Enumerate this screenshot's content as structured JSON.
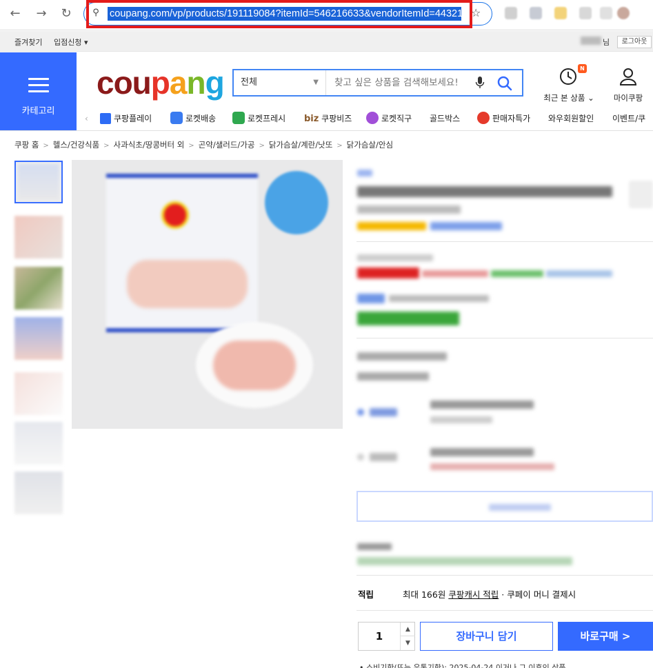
{
  "browser": {
    "url": "coupang.com/vp/products/191119084?itemId=546216633&vendorItemId=44321",
    "back_icon": "arrow-left-icon",
    "forward_icon": "arrow-right-icon",
    "reload_icon": "reload-icon"
  },
  "util_bar": {
    "bookmark": "즐겨찾기",
    "seller_signup": "입점신청 ▾",
    "user_suffix": "님",
    "logout": "로그아웃"
  },
  "header": {
    "category_label": "카테고리",
    "logo": [
      "cou",
      "p",
      "a",
      "n",
      "g"
    ],
    "search_category": "전체",
    "search_placeholder": "찾고 싶은 상품을 검색해보세요!",
    "recent_label": "최근 본 상품 ⌄",
    "recent_badge": "N",
    "mypage_label": "마이쿠팡"
  },
  "gnb": {
    "items": [
      {
        "label": "쿠팡플레이",
        "color": "#2d6cf5"
      },
      {
        "label": "로켓배송",
        "color": "#3a7bf0"
      },
      {
        "label": "로켓프레시",
        "color": "#2fa84f"
      },
      {
        "label": "쿠팡비즈",
        "prefix": "biz",
        "color": "#8a5a2b"
      },
      {
        "label": "로켓직구",
        "color": "#a14fd8"
      },
      {
        "label": "골드박스",
        "color": ""
      },
      {
        "label": "판매자특가",
        "color": "#e53a2b"
      },
      {
        "label": "와우회원할인",
        "color": ""
      },
      {
        "label": "이벤트/쿠",
        "color": ""
      }
    ]
  },
  "breadcrumb": [
    "쿠팡 홈",
    "헬스/건강식품",
    "사과식초/땅콩버터 외",
    "곤약/샐러드/가공",
    "닭가슴살/계란/낫또",
    "닭가슴살/안심"
  ],
  "purchase": {
    "reward_label": "적립",
    "reward_prefix": "최대 166원 ",
    "reward_link": "쿠팡캐시 적립",
    "reward_suffix": " · 쿠페이 머니 결제시",
    "quantity": "1",
    "cart_button": "장바구니 담기",
    "buy_button": "바로구매 >"
  },
  "bottom_note": "• 소비기한(또는 유통기한): 2025-04-24 이거나 그 이후인 상품",
  "colors": {
    "brand_blue": "#346aff",
    "highlight_red": "#e31b1b"
  }
}
